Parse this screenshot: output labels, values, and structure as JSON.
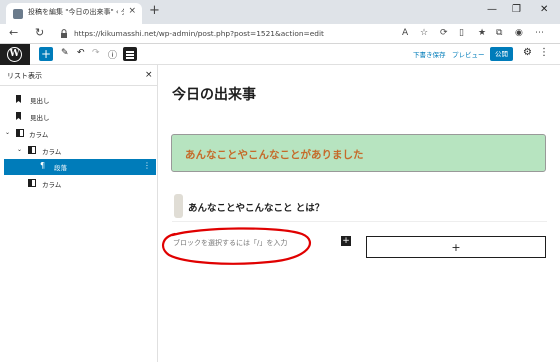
{
  "browser": {
    "tab_title": "投稿を編集 \"今日の出来事\" ‹ ダウ",
    "tab_close": "×",
    "new_tab": "+",
    "url": "https://kikumasshi.net/wp-admin/post.php?post=1521&action=edit",
    "window_controls": [
      "—",
      "❐",
      "✕"
    ],
    "nav": {
      "back": "←",
      "reload": "↻"
    }
  },
  "wp_header": {
    "logo": "W",
    "inserter": "+",
    "save_draft": "下書き保存",
    "preview": "プレビュー",
    "publish": "公開",
    "settings": "⚙",
    "more": "⋮",
    "icons": [
      "pencil-icon",
      "undo-icon",
      "redo-icon",
      "info-icon",
      "list-view-icon"
    ]
  },
  "sidebar": {
    "title": "リスト表示",
    "close": "×",
    "items": [
      {
        "label": "見出し",
        "icon": "bookmark-icon"
      },
      {
        "label": "見出し",
        "icon": "bookmark-icon"
      },
      {
        "label": "カラム",
        "icon": "columns-icon"
      },
      {
        "label": "カラム",
        "icon": "column-icon"
      },
      {
        "label": "段落",
        "icon": "paragraph-icon"
      },
      {
        "label": "カラム",
        "icon": "column-icon"
      }
    ]
  },
  "editor": {
    "post_title": "今日の出来事",
    "green_paragraph": "あんなことやこんなことがありました",
    "heading": "あんなことやこんなこと とは？",
    "placeholder": "ブロックを選択するには「/」を入力",
    "column_appender": "+",
    "block_plus": "+"
  },
  "colors": {
    "accent": "#007cba",
    "green_bg": "#b7e4c0",
    "green_text": "#c56b2a",
    "annotation": "#e00000"
  }
}
